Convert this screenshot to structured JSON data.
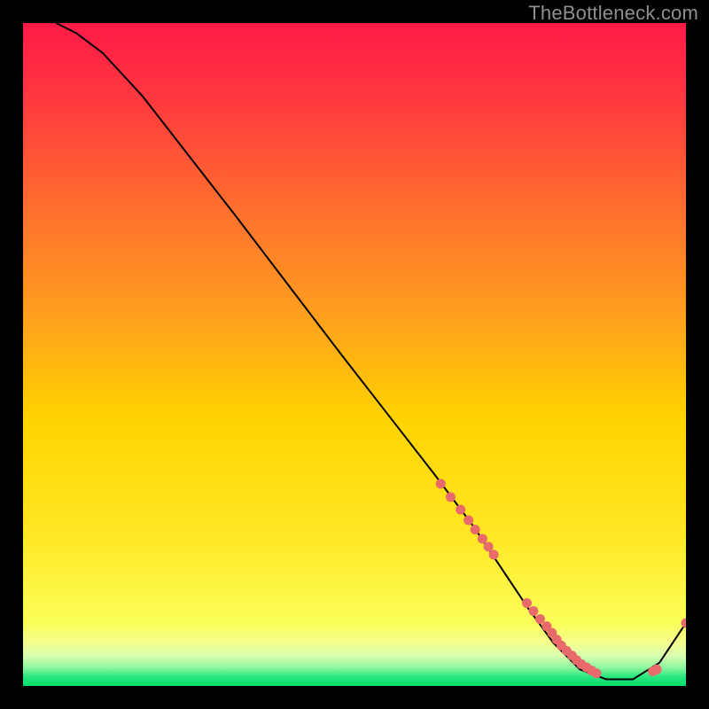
{
  "watermark": "TheBottleneck.com",
  "chart_data": {
    "type": "line",
    "title": "",
    "xlabel": "",
    "ylabel": "",
    "xlim": [
      0,
      100
    ],
    "ylim": [
      0,
      100
    ],
    "grid": false,
    "background_gradient_top": "#ff1a47",
    "background_gradient_mid": "#ffd400",
    "background_bottom_band": "#00e06a",
    "series": [
      {
        "name": "curve",
        "type": "line",
        "color": "#000000",
        "x": [
          5,
          8,
          12,
          18,
          25,
          32,
          40,
          48,
          55,
          62,
          68,
          72,
          76,
          80,
          84,
          88,
          92,
          96,
          100
        ],
        "y": [
          100,
          98.5,
          95.5,
          89,
          80,
          71,
          60.5,
          50,
          41,
          32,
          24,
          18,
          12,
          6.5,
          2.5,
          1.0,
          1.0,
          3.5,
          9.5
        ]
      },
      {
        "name": "markers",
        "type": "scatter",
        "color": "#e96a6a",
        "x": [
          63,
          64.5,
          66,
          67.2,
          68.2,
          69.3,
          70.2,
          71,
          76,
          77,
          78,
          79,
          79.8,
          80.5,
          81.2,
          82,
          82.8,
          83.5,
          84.2,
          85,
          85.8,
          86.5,
          95,
          95.6,
          100
        ],
        "y": [
          30.5,
          28.5,
          26.6,
          25,
          23.6,
          22.2,
          21,
          19.8,
          12.5,
          11.3,
          10.1,
          9,
          8,
          7,
          6.1,
          5.3,
          4.6,
          3.9,
          3.3,
          2.8,
          2.3,
          1.9,
          2.2,
          2.5,
          9.5
        ]
      }
    ]
  }
}
